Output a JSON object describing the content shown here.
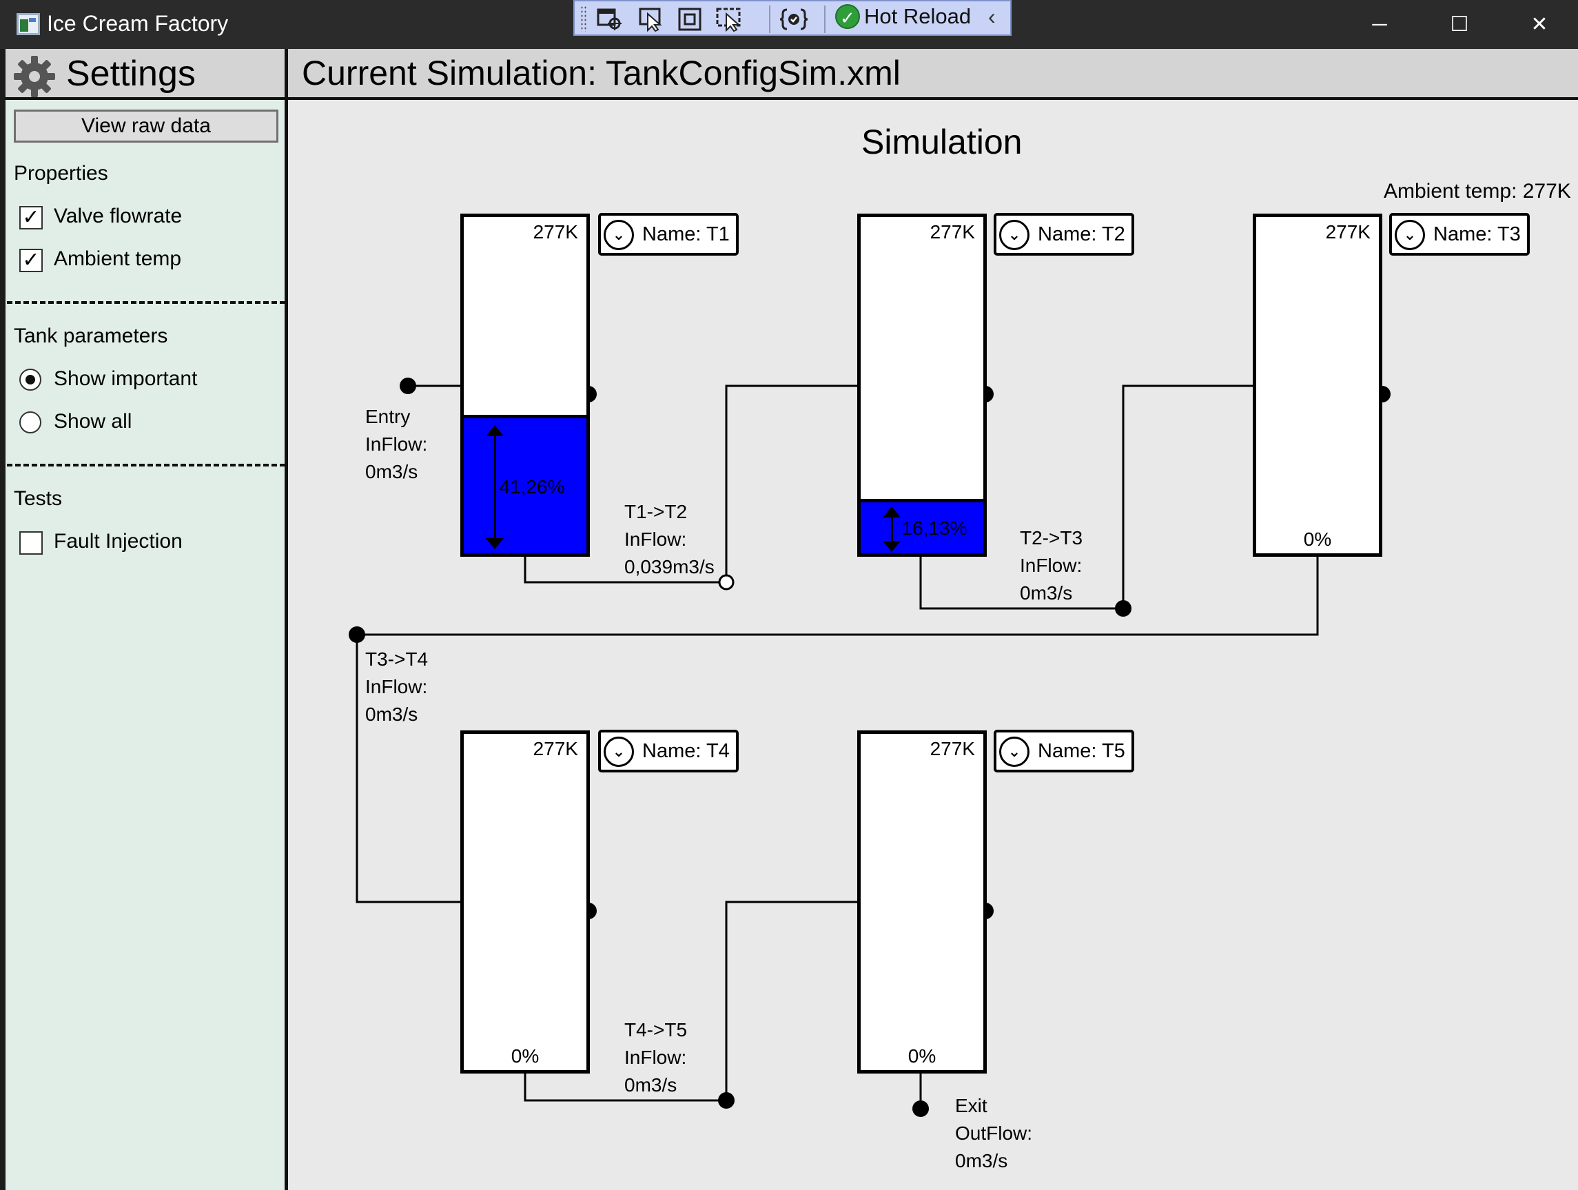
{
  "window": {
    "title": "Ice Cream Factory",
    "minimize_glyph": "─",
    "maximize_glyph": "☐",
    "close_glyph": "✕"
  },
  "dev_toolbar": {
    "hot_reload_label": "Hot Reload",
    "hot_reload_check_glyph": "✓",
    "collapse_glyph": "‹",
    "tools": [
      "select-element-icon",
      "select-pointer-icon",
      "display-layout-adorners-icon",
      "track-focused-element-icon",
      "binding-failures-icon"
    ]
  },
  "sidebar": {
    "title": "Settings",
    "view_raw_button": "View raw data",
    "properties_heading": "Properties",
    "properties": [
      {
        "label": "Valve flowrate",
        "checked": true
      },
      {
        "label": "Ambient temp",
        "checked": true
      }
    ],
    "tank_params_heading": "Tank parameters",
    "tank_params": [
      {
        "label": "Show important",
        "selected": true
      },
      {
        "label": "Show all",
        "selected": false
      }
    ],
    "tests_heading": "Tests",
    "tests": [
      {
        "label": "Fault Injection",
        "checked": false
      }
    ],
    "check_glyph": "✓"
  },
  "main": {
    "current_simulation": "Current Simulation: TankConfigSim.xml",
    "simulation_title": "Simulation",
    "ambient_temp": "Ambient temp: 277K",
    "chevron_glyph": "⌄",
    "tanks": [
      {
        "name": "Name: T1",
        "temp": "277K",
        "fill": 0.4126,
        "level": "41,26%"
      },
      {
        "name": "Name: T2",
        "temp": "277K",
        "fill": 0.1613,
        "level": "16,13%"
      },
      {
        "name": "Name: T3",
        "temp": "277K",
        "fill": 0,
        "level": "0%"
      },
      {
        "name": "Name: T4",
        "temp": "277K",
        "fill": 0,
        "level": "0%"
      },
      {
        "name": "Name: T5",
        "temp": "277K",
        "fill": 0,
        "level": "0%"
      }
    ],
    "flows": {
      "entry": [
        "Entry",
        "InFlow:",
        "0m3/s"
      ],
      "t1_t2": [
        "T1->T2",
        "InFlow:",
        "0,039m3/s"
      ],
      "t2_t3": [
        "T2->T3",
        "InFlow:",
        "0m3/s"
      ],
      "t3_t4": [
        "T3->T4",
        "InFlow:",
        "0m3/s"
      ],
      "t4_t5": [
        "T4->T5",
        "InFlow:",
        "0m3/s"
      ],
      "exit": [
        "Exit",
        "OutFlow:",
        "0m3/s"
      ]
    }
  }
}
